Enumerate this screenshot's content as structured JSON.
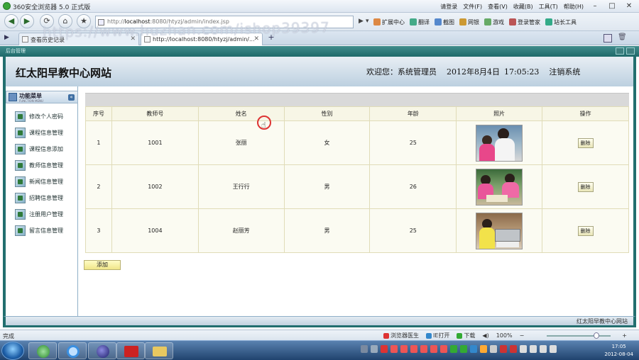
{
  "browser": {
    "title": "360安全浏览器 5.0 正式版",
    "top_links": [
      "请登录",
      "文件(F)",
      "查看(V)",
      "收藏(B)",
      "工具(T)",
      "帮助(H)"
    ],
    "address_prefix": "http://",
    "address_host": "localhost",
    "address_rest": ":8080/htyzj/admin/index.jsp",
    "toolbar": [
      "扩展中心",
      "翻译",
      "截图",
      "网银",
      "游戏",
      "登录管家",
      "站长工具"
    ],
    "tabs": [
      {
        "label": "查看历史记录"
      },
      {
        "label": "http://localhost:8080/htyzj/admin/..."
      }
    ],
    "status_left": "完成",
    "status_right": [
      "浏览器医生",
      "IE打开",
      "下载"
    ],
    "zoom": "100%"
  },
  "site": {
    "system_label": "后台管理",
    "title": "红太阳早教中心网站",
    "welcome": "欢迎您：系统管理员",
    "date": "2012年8月4日",
    "time": "17:05:23",
    "logout": "注销系统",
    "footer": "红太阳早教中心网站"
  },
  "sidebar": {
    "title": "功能菜单",
    "subtitle": "FUNCTION MENU",
    "items": [
      {
        "label": "修改个人密码"
      },
      {
        "label": "课程信息管理"
      },
      {
        "label": "课程信息添加"
      },
      {
        "label": "教师信息管理"
      },
      {
        "label": "新闻信息管理"
      },
      {
        "label": "招聘信息管理"
      },
      {
        "label": "注册用户管理"
      },
      {
        "label": "留言信息管理"
      }
    ]
  },
  "table": {
    "headers": [
      "序号",
      "教师号",
      "姓名",
      "性别",
      "年龄",
      "照片",
      "操作"
    ],
    "rows": [
      {
        "no": "1",
        "teacher_no": "1001",
        "name": "张丽",
        "gender": "女",
        "age": "25",
        "action": "删除"
      },
      {
        "no": "2",
        "teacher_no": "1002",
        "name": "王行行",
        "gender": "男",
        "age": "26",
        "action": "删除"
      },
      {
        "no": "3",
        "teacher_no": "1004",
        "name": "赵丽芳",
        "gender": "男",
        "age": "25",
        "action": "删除"
      }
    ],
    "add_label": "添加"
  },
  "taskbar": {
    "clock_time": "17:05",
    "clock_date": "2012-08-04"
  },
  "watermark": "https://www.huzhan.com/ishop39397"
}
